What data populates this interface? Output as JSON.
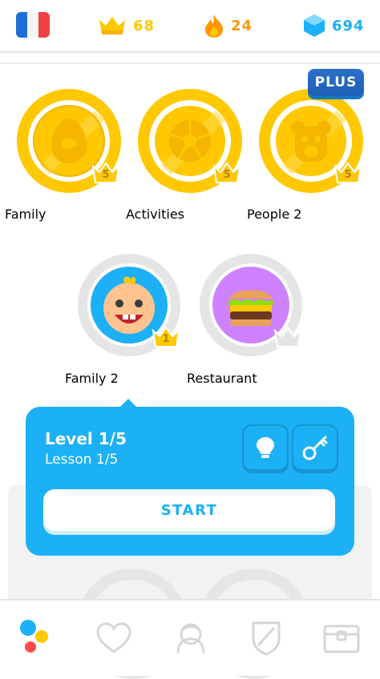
{
  "header": {
    "language": "French",
    "crowns": "68",
    "streak": "24",
    "gems": "694",
    "colors": {
      "crown": "#ffc800",
      "streak": "#ff9600",
      "gems": "#1cb0f6"
    }
  },
  "plus_badge": "PLUS",
  "skills_row1": [
    {
      "label": "Family",
      "crown_level": "5",
      "icon": "egg-icon"
    },
    {
      "label": "Activities",
      "crown_level": "5",
      "icon": "soccer-ball-icon"
    },
    {
      "label": "People 2",
      "crown_level": "5",
      "icon": "bear-icon"
    }
  ],
  "skills_row2": [
    {
      "label": "Family 2",
      "crown_level": "1",
      "icon": "baby-face-icon",
      "progress": 0.0
    },
    {
      "label": "Restaurant",
      "crown_level": "",
      "icon": "burger-icon",
      "progress": 0.0
    }
  ],
  "popup": {
    "title": "Level 1/5",
    "subtitle": "Lesson 1/5",
    "start_label": "START",
    "color": "#1cb0f6"
  },
  "bottom_nav": [
    "learn-icon",
    "heart-icon",
    "profile-icon",
    "shield-icon",
    "chest-icon"
  ]
}
